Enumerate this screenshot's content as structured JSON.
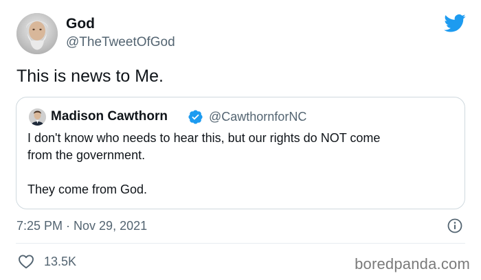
{
  "tweet": {
    "author_name": "God",
    "author_handle": "@TheTweetOfGod",
    "text": "This is news to Me.",
    "timestamp": "7:25 PM · Nov 29, 2021",
    "likes": "13.5K"
  },
  "quote": {
    "author_name": "Madison Cawthorn",
    "author_handle": "@CawthornforNC",
    "line1": "I don't know who needs to hear this, but our rights do NOT come",
    "line2": "from the government.",
    "line3": "They come from God."
  },
  "watermark": "boredpanda.com",
  "icons": {
    "brand": "twitter-bird-icon",
    "verified": "verified-badge-icon",
    "info": "info-icon",
    "like": "heart-icon"
  },
  "colors": {
    "twitter_blue": "#1d9bf0",
    "text_primary": "#0f1419",
    "text_secondary": "#536471",
    "border": "#cfd9de"
  }
}
